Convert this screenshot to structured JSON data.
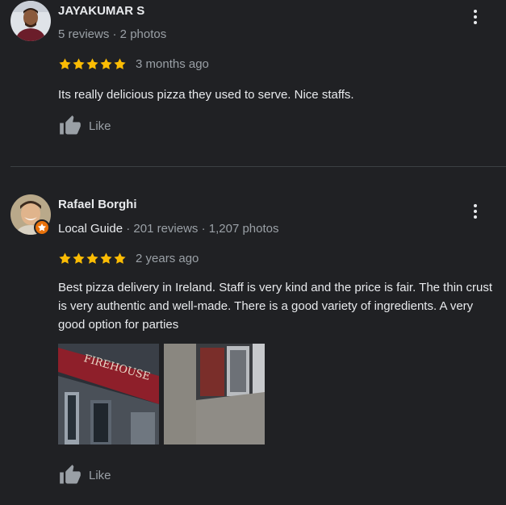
{
  "colors": {
    "background": "#202124",
    "star": "#fbbc04",
    "text_primary": "#e8eaed",
    "text_secondary": "#9aa0a6",
    "local_guide_badge": "#e8710a"
  },
  "reviews": [
    {
      "reviewer_name": "JAYAKUMAR S",
      "meta": "5 reviews · 2 photos",
      "rating": 5,
      "time": "3 months ago",
      "text": "Its really delicious pizza they used to serve. Nice staffs.",
      "like_label": "Like",
      "icons": {
        "menu": "more-vert-icon",
        "like": "thumb-up-icon",
        "star": "star-icon"
      }
    },
    {
      "reviewer_name": "Rafael Borghi",
      "local_guide_label": "Local Guide",
      "meta": " · 201 reviews · 1,207 photos",
      "rating": 5,
      "time": "2 years ago",
      "text": "Best pizza delivery in Ireland. Staff is very kind and the price is fair. The thin crust is very authentic and well-made. There is a good variety of ingredients. A very good option for parties",
      "photos_count_shown": 2,
      "like_label": "Like",
      "icons": {
        "menu": "more-vert-icon",
        "like": "thumb-up-icon",
        "star": "star-icon",
        "badge": "local-guide-badge-icon"
      }
    }
  ]
}
